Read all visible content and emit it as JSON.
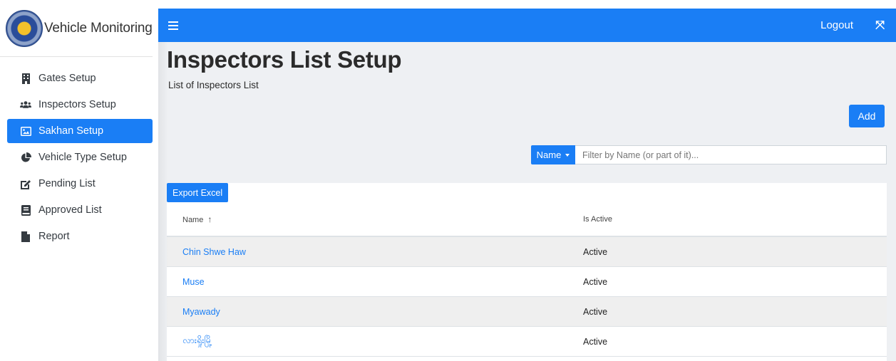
{
  "brand": {
    "title": "Vehicle Monitoring",
    "logo": "seal-logo"
  },
  "sidebar": {
    "items": [
      {
        "label": "Gates Setup",
        "icon": "building-icon",
        "active": false
      },
      {
        "label": "Inspectors Setup",
        "icon": "users-icon",
        "active": false
      },
      {
        "label": "Sakhan Setup",
        "icon": "image-icon",
        "active": true
      },
      {
        "label": "Vehicle Type Setup",
        "icon": "pie-chart-icon",
        "active": false
      },
      {
        "label": "Pending List",
        "icon": "edit-icon",
        "active": false
      },
      {
        "label": "Approved List",
        "icon": "book-icon",
        "active": false
      },
      {
        "label": "Report",
        "icon": "file-icon",
        "active": false
      }
    ]
  },
  "topbar": {
    "logout_label": "Logout",
    "expand_icon": "expand-icon",
    "menu_icon": "hamburger-icon"
  },
  "page": {
    "title": "Inspectors List Setup",
    "subtitle": "List of Inspectors List"
  },
  "toolbar": {
    "add_label": "Add"
  },
  "filter": {
    "field_label": "Name",
    "placeholder": "Filter by Name (or part of it)..."
  },
  "table": {
    "export_label": "Export Excel",
    "columns": [
      "Name",
      "Is Active"
    ],
    "sort_indicator": "↑",
    "rows": [
      {
        "name": "Chin Shwe Haw",
        "status": "Active"
      },
      {
        "name": "Muse",
        "status": "Active"
      },
      {
        "name": "Myawady",
        "status": "Active"
      },
      {
        "name": "လားရှိုးမြို့",
        "status": "Active"
      }
    ]
  },
  "colors": {
    "primary": "#1a7ef5",
    "content_bg": "#eef0f3",
    "stripe": "#efefef"
  }
}
